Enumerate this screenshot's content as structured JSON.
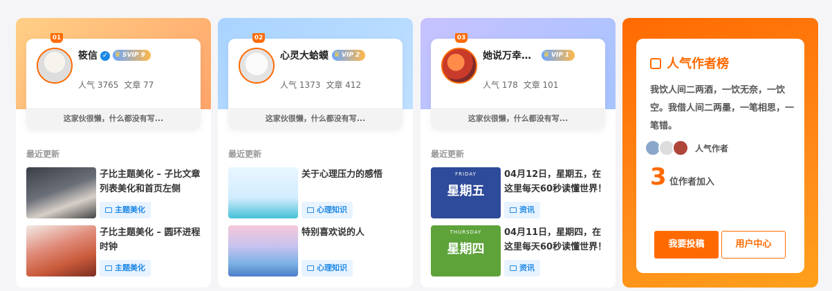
{
  "authors": [
    {
      "rank": "01",
      "name": "筱信",
      "vip": "SVIP 9",
      "popularity": "人气 3765",
      "articles": "文章 77",
      "bio": "这家伙很懒，什么都没有写...",
      "recent_title": "最近更新",
      "posts": [
        {
          "title": "子比主题美化 – 子比文章列表美化和首页左侧",
          "tag": "主题美化"
        },
        {
          "title": "子比主题美化 – 圆环进程时钟",
          "tag": "主题美化"
        }
      ]
    },
    {
      "rank": "02",
      "name": "心灵大蛤蟆",
      "vip": "VIP 2",
      "popularity": "人气 1373",
      "articles": "文章 412",
      "bio": "这家伙很懒，什么都没有写...",
      "recent_title": "最近更新",
      "posts": [
        {
          "title": "关于心理压力的感悟",
          "tag": "心理知识"
        },
        {
          "title": "特别喜欢说的人",
          "tag": "心理知识"
        }
      ]
    },
    {
      "rank": "03",
      "name": "她说万幸…",
      "vip": "VIP 1",
      "popularity": "人气 178",
      "articles": "文章 101",
      "bio": "这家伙很懒，什么都没有写...",
      "recent_title": "最近更新",
      "posts": [
        {
          "title": "04月12日，星期五，在这里每天60秒读懂世界！",
          "tag": "资讯",
          "thumb": {
            "small": "FRIDAY",
            "big": "星期五"
          }
        },
        {
          "title": "04月11日，星期四，在这里每天60秒读懂世界！",
          "tag": "资讯",
          "thumb": {
            "small": "THURSDAY",
            "big": "星期四"
          }
        }
      ]
    }
  ],
  "ranking": {
    "title": "人气作者榜",
    "quote": "我饮人间二两酒，一饮无奈，一饮空。我借人间二两墨，一笔相思，一笔错。",
    "popular_label": "人气作者",
    "count": "3",
    "join_text": "位作者加入",
    "submit_button": "我要投稿",
    "user_center_button": "用户中心"
  },
  "colors": {
    "accent": "#ff6a00",
    "tag_blue": "#1e88e5"
  }
}
